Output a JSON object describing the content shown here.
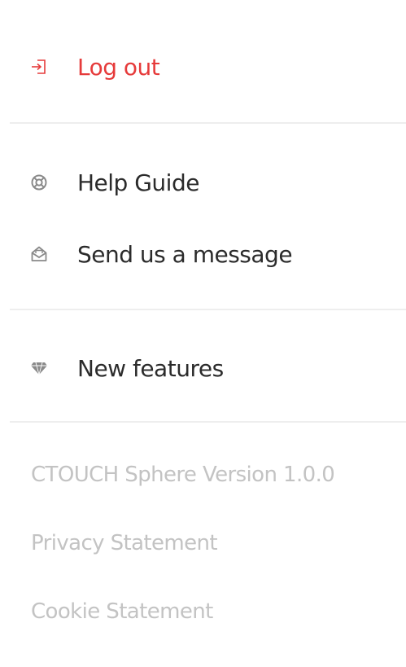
{
  "menu": {
    "logout": {
      "label": "Log out",
      "icon": "logout-icon"
    },
    "help_guide": {
      "label": "Help Guide",
      "icon": "lifebuoy-icon"
    },
    "send_message": {
      "label": "Send us a message",
      "icon": "envelope-icon"
    },
    "new_features": {
      "label": "New features",
      "icon": "diamond-icon"
    }
  },
  "footer": {
    "version": "CTOUCH Sphere Version 1.0.0",
    "privacy": "Privacy Statement",
    "cookie": "Cookie Statement"
  },
  "colors": {
    "logout": "#e63b3b",
    "text": "#2b2b2b",
    "muted": "#c3c3c3",
    "icon": "#8a8a8a",
    "divider": "#eeeeee"
  }
}
